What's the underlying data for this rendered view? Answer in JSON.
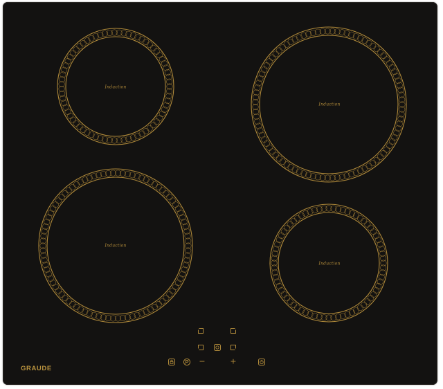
{
  "product": {
    "brand": "GRAUDE",
    "surface_color": "#131211",
    "accent_color": "#b08a3a"
  },
  "cooking_zones": [
    {
      "id": "zone-front-left-small",
      "label": "Induction"
    },
    {
      "id": "zone-rear-right-large",
      "label": "Induction"
    },
    {
      "id": "zone-front-left-large",
      "label": "Induction"
    },
    {
      "id": "zone-front-right-small",
      "label": "Induction"
    }
  ],
  "controls": {
    "zone_selectors": [
      "zone-select-rear-left-icon",
      "zone-select-rear-right-icon",
      "zone-select-front-left-icon",
      "zone-select-front-right-icon"
    ],
    "timer_icon": "timer-icon",
    "lock_icon": "child-lock-icon",
    "power_boost_icon": "power-boost-icon",
    "minus_label": "−",
    "plus_label": "+",
    "power_icon": "power-icon"
  }
}
